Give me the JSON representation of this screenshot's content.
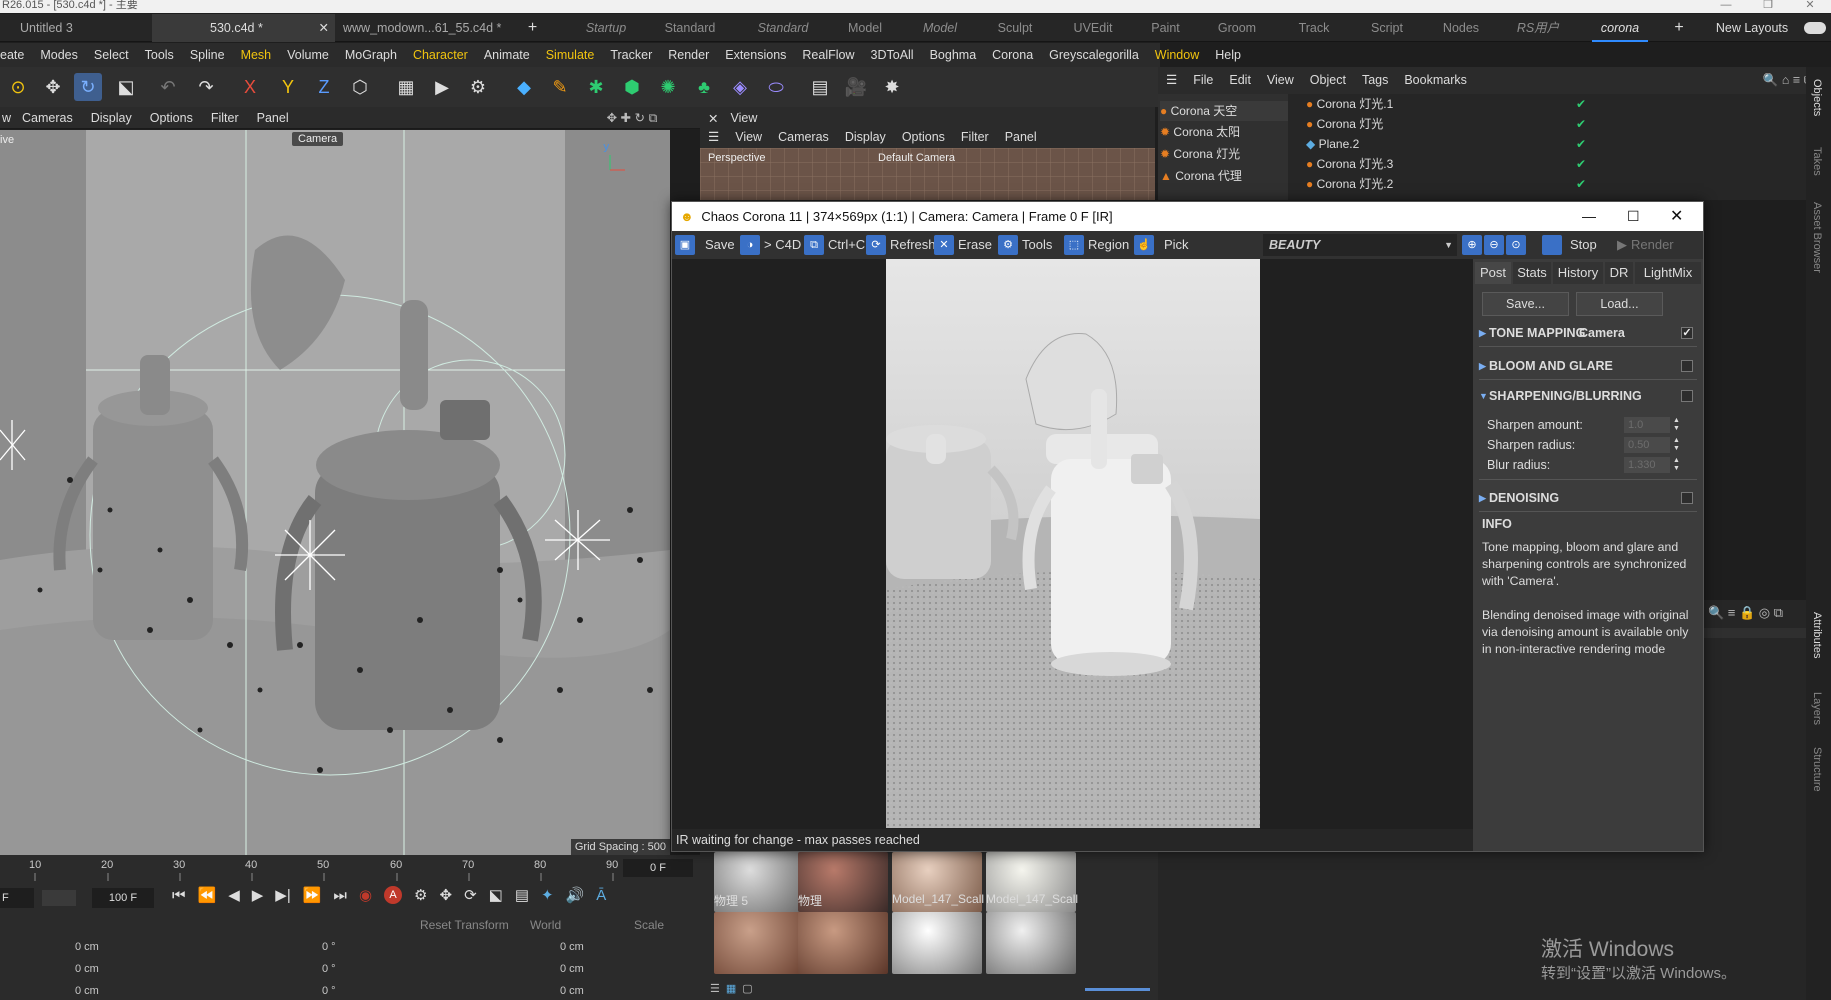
{
  "app_title": "R26.015 - [530.c4d *] - 主要",
  "doc_tabs": [
    "Untitled 3",
    "530.c4d *",
    "www_modown...61_55.c4d *"
  ],
  "layouts": [
    "Startup",
    "Standard",
    "Standard",
    "Model",
    "Model",
    "Sculpt",
    "UVEdit",
    "Paint",
    "Groom",
    "Track",
    "Script",
    "Nodes",
    "RS用户",
    "corona"
  ],
  "new_layouts": "New Layouts",
  "menus": [
    "eate",
    "Modes",
    "Select",
    "Tools",
    "Spline",
    "Mesh",
    "Volume",
    "MoGraph",
    "Character",
    "Animate",
    "Simulate",
    "Tracker",
    "Render",
    "Extensions",
    "RealFlow",
    "3DToAll",
    "Boghma",
    "Corona",
    "Greyscalegorilla",
    "Window",
    "Help"
  ],
  "viewport_menu": [
    "Cameras",
    "Display",
    "Options",
    "Filter",
    "Panel"
  ],
  "viewport_left_label": "ive",
  "camera_tag": "Camera",
  "grid_spacing": "Grid Spacing : 500",
  "view_title": "View",
  "view_menu": [
    "View",
    "Cameras",
    "Display",
    "Options",
    "Filter",
    "Panel"
  ],
  "perspective": "Perspective",
  "default_camera": "Default Camera",
  "obj_menu": [
    "File",
    "Edit",
    "View",
    "Object",
    "Tags",
    "Bookmarks"
  ],
  "materials_list": [
    "Corona 天空",
    "Corona 太阳",
    "Corona 灯光",
    "Corona 代理"
  ],
  "objects": [
    "Corona 灯光.1",
    "Corona 灯光",
    "Plane.2",
    "Corona 灯光.3",
    "Corona 灯光.2"
  ],
  "side_tabs": [
    "Objects",
    "Takes",
    "Asset Browser",
    "Attributes",
    "Layers",
    "Structure"
  ],
  "corona": {
    "title": "Chaos Corona 11 | 374×569px (1:1) | Camera: Camera | Frame 0 F [IR]",
    "save": "Save",
    "to_c4d": "> C4D",
    "ctrlc": "Ctrl+C",
    "refresh": "Refresh",
    "erase": "Erase",
    "tools": "Tools",
    "region": "Region",
    "pick": "Pick",
    "beauty": "BEAUTY",
    "stop": "Stop",
    "render": "Render",
    "status": "IR waiting for change - max passes reached",
    "tabs": [
      "Post",
      "Stats",
      "History",
      "DR",
      "LightMix"
    ],
    "save_btn": "Save...",
    "load_btn": "Load...",
    "tone_mapping": "TONE MAPPING",
    "tone_camera": "Camera",
    "bloom": "BLOOM AND GLARE",
    "sharpen": "SHARPENING/BLURRING",
    "sharpen_amount_label": "Sharpen amount:",
    "sharpen_amount": "1.0",
    "sharpen_radius_label": "Sharpen radius:",
    "sharpen_radius": "0.50",
    "blur_radius_label": "Blur radius:",
    "blur_radius": "1.330",
    "denoising": "DENOISING",
    "info_title": "INFO",
    "info1": "Tone mapping, bloom and glare and sharpening controls are synchronized with 'Camera'.",
    "info2": "Blending denoised image with original via denoising amount is available only in non-interactive rendering mode"
  },
  "timeline_ticks": [
    "10",
    "20",
    "30",
    "40",
    "50",
    "60",
    "70",
    "80",
    "90"
  ],
  "frame_current": "0 F",
  "frame_start": "F",
  "frame_end": "100 F",
  "reset_transform": "Reset Transform",
  "world": "World",
  "scale": "Scale",
  "coord_rows": [
    [
      "0 cm",
      "0 °",
      "0 cm"
    ],
    [
      "0 cm",
      "0 °",
      "0 cm"
    ],
    [
      "0 cm",
      "0 °",
      "0 cm"
    ]
  ],
  "mat_labels": [
    "物理 5",
    "物理",
    "Model_147_Scall",
    "Model_147_Scall"
  ],
  "activate_line1": "激活 Windows",
  "activate_line2": "转到“设置”以激活 Windows。"
}
